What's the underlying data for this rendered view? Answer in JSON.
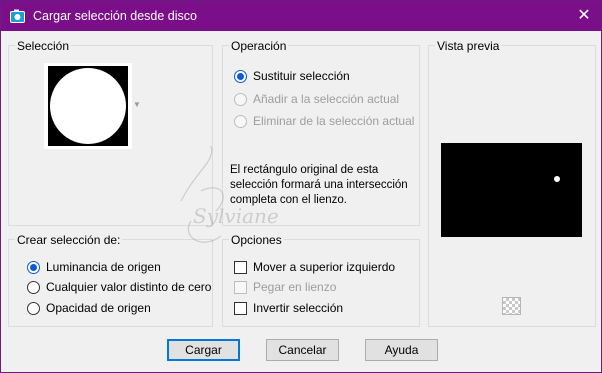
{
  "window": {
    "title": "Cargar selección desde disco",
    "close_symbol": "✕"
  },
  "seleccion": {
    "label": "Selección"
  },
  "operacion": {
    "label": "Operación",
    "options": [
      {
        "label": "Sustituir selección",
        "checked": true,
        "enabled": true
      },
      {
        "label": "Añadir a la selección actual",
        "checked": false,
        "enabled": false
      },
      {
        "label": "Eliminar de la selección actual",
        "checked": false,
        "enabled": false
      }
    ],
    "info": "El rectángulo original de esta selección formará una intersección completa con el lienzo."
  },
  "vista_previa": {
    "label": "Vista previa"
  },
  "crear": {
    "label": "Crear selección de:",
    "options": [
      {
        "label": "Luminancia de origen",
        "checked": true
      },
      {
        "label": "Cualquier valor distinto de cero",
        "checked": false
      },
      {
        "label": "Opacidad de origen",
        "checked": false
      }
    ]
  },
  "opciones": {
    "label": "Opciones",
    "options": [
      {
        "label": "Mover a superior izquierdo",
        "checked": false,
        "enabled": true
      },
      {
        "label": "Pegar en lienzo",
        "checked": false,
        "enabled": false
      },
      {
        "label": "Invertir selección",
        "checked": false,
        "enabled": true
      }
    ]
  },
  "buttons": {
    "load": "Cargar",
    "cancel": "Cancelar",
    "help": "Ayuda"
  },
  "watermark_text": "Sylviane",
  "colors": {
    "titlebar": "#7b0f8a",
    "accent": "#0a5ad7"
  }
}
